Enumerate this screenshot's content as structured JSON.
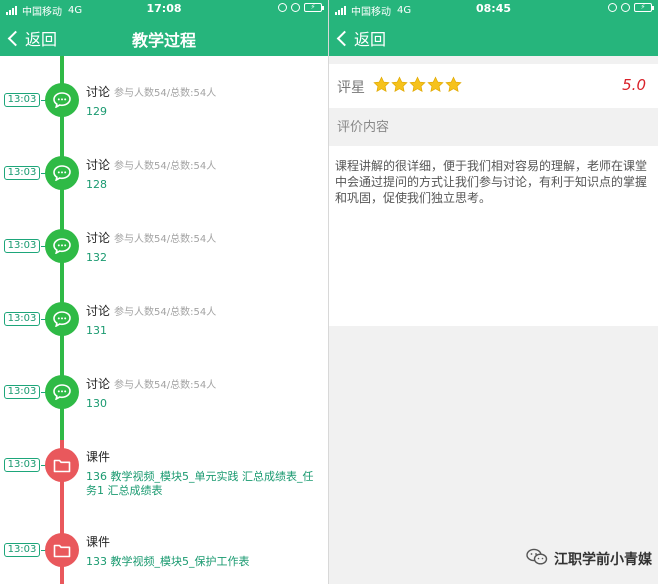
{
  "left": {
    "status": {
      "carrier": "中国移动",
      "network": "4G",
      "time": "17:08"
    },
    "nav": {
      "back_label": "返回",
      "title": "教学过程"
    },
    "items": [
      {
        "time": "13:03",
        "type": "chat",
        "title": "讨论",
        "meta": "参与人数54/总数:54人",
        "sub": "129"
      },
      {
        "time": "13:03",
        "type": "chat",
        "title": "讨论",
        "meta": "参与人数54/总数:54人",
        "sub": "128"
      },
      {
        "time": "13:03",
        "type": "chat",
        "title": "讨论",
        "meta": "参与人数54/总数:54人",
        "sub": "132"
      },
      {
        "time": "13:03",
        "type": "chat",
        "title": "讨论",
        "meta": "参与人数54/总数:54人",
        "sub": "131"
      },
      {
        "time": "13:03",
        "type": "chat",
        "title": "讨论",
        "meta": "参与人数54/总数:54人",
        "sub": "130"
      },
      {
        "time": "13:03",
        "type": "file",
        "title": "课件",
        "meta": "",
        "sub": "136 教学视频_模块5_单元实践 汇总成绩表_任务1 汇总成绩表"
      },
      {
        "time": "13:03",
        "type": "file",
        "title": "课件",
        "meta": "",
        "sub": "133 教学视频_模块5_保护工作表"
      }
    ]
  },
  "right": {
    "status": {
      "carrier": "中国移动",
      "network": "4G",
      "time": "08:45"
    },
    "nav": {
      "back_label": "返回"
    },
    "rating": {
      "label": "评星",
      "stars": 5,
      "score": "5.0"
    },
    "content_label": "评价内容",
    "content_text": "课程讲解的很详细，便于我们相对容易的理解，老师在课堂中会通过提问的方式让我们参与讨论，有利于知识点的掌握和巩固，促使我们独立思考。"
  },
  "watermark": "江职学前小青媒",
  "colors": {
    "nav": "#26b57c",
    "chat_node": "#2fba46",
    "file_node": "#e9585c",
    "link": "#1a9a70",
    "score": "#d9222a",
    "star": "#f6c21c"
  }
}
